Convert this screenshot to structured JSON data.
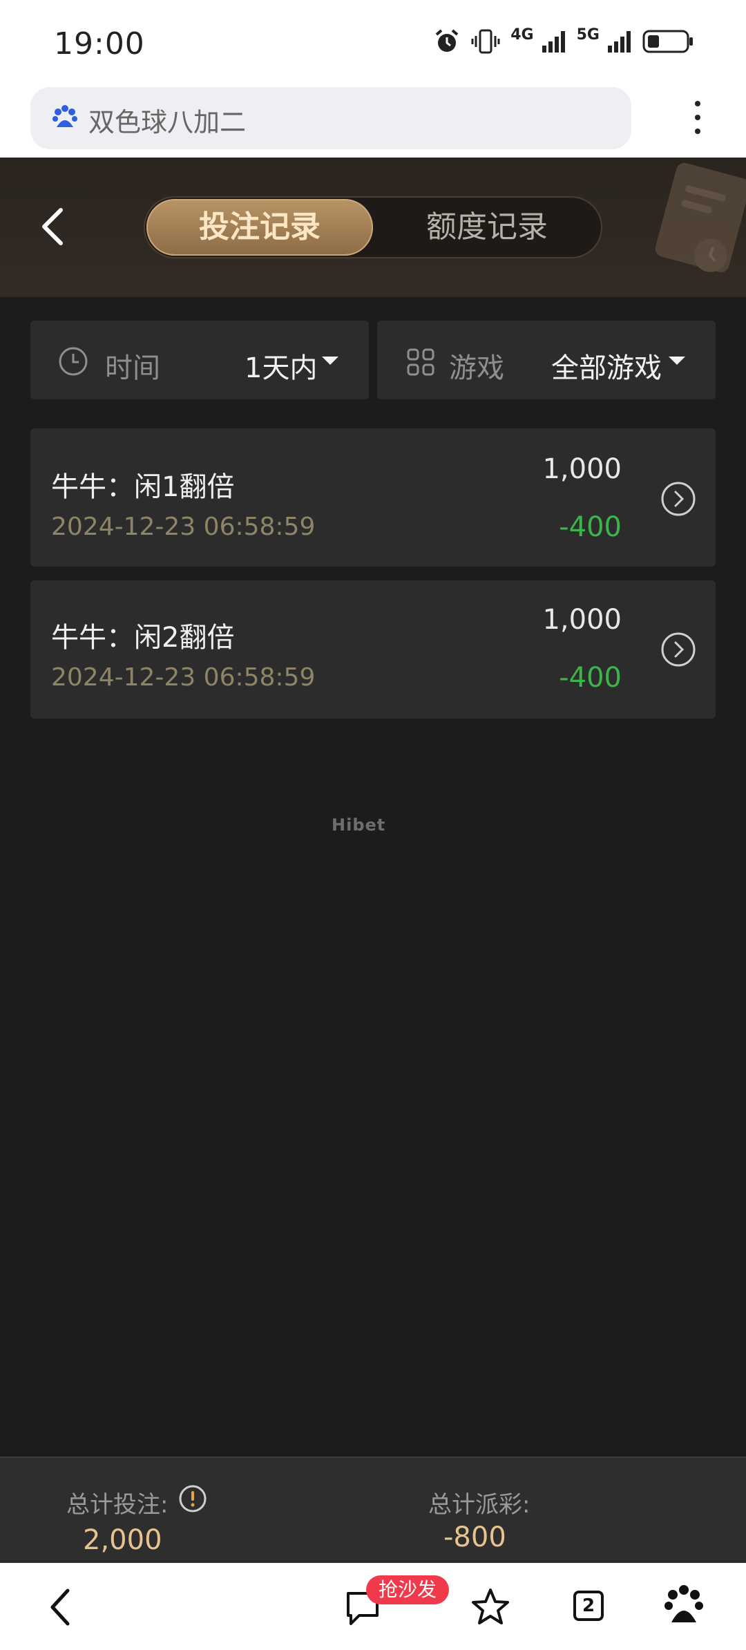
{
  "status_bar": {
    "time": "19:00",
    "net1": "4G",
    "net2": "5G"
  },
  "browser": {
    "address_text": "双色球八加二"
  },
  "header": {
    "tabs": [
      "投注记录",
      "额度记录"
    ]
  },
  "filters": {
    "time": {
      "label": "时间",
      "value": "1天内"
    },
    "game": {
      "label": "游戏",
      "value": "全部游戏"
    }
  },
  "records": [
    {
      "title": "牛牛：闲1翻倍",
      "date": "2024-12-23 06:58:59",
      "bet": "1,000",
      "payout": "-400"
    },
    {
      "title": "牛牛：闲2翻倍",
      "date": "2024-12-23 06:58:59",
      "bet": "1,000",
      "payout": "-400"
    }
  ],
  "watermark": "Hibet",
  "summary": {
    "total_bet_label": "总计投注:",
    "total_bet": "2,000",
    "total_payout_label": "总计派彩:",
    "total_payout": "-800"
  },
  "bottom_nav": {
    "badge": "抢沙发",
    "tab_count": "2"
  },
  "colors": {
    "accent": "#b89466",
    "win": "#3ab54a",
    "gold": "#e8c38d"
  }
}
